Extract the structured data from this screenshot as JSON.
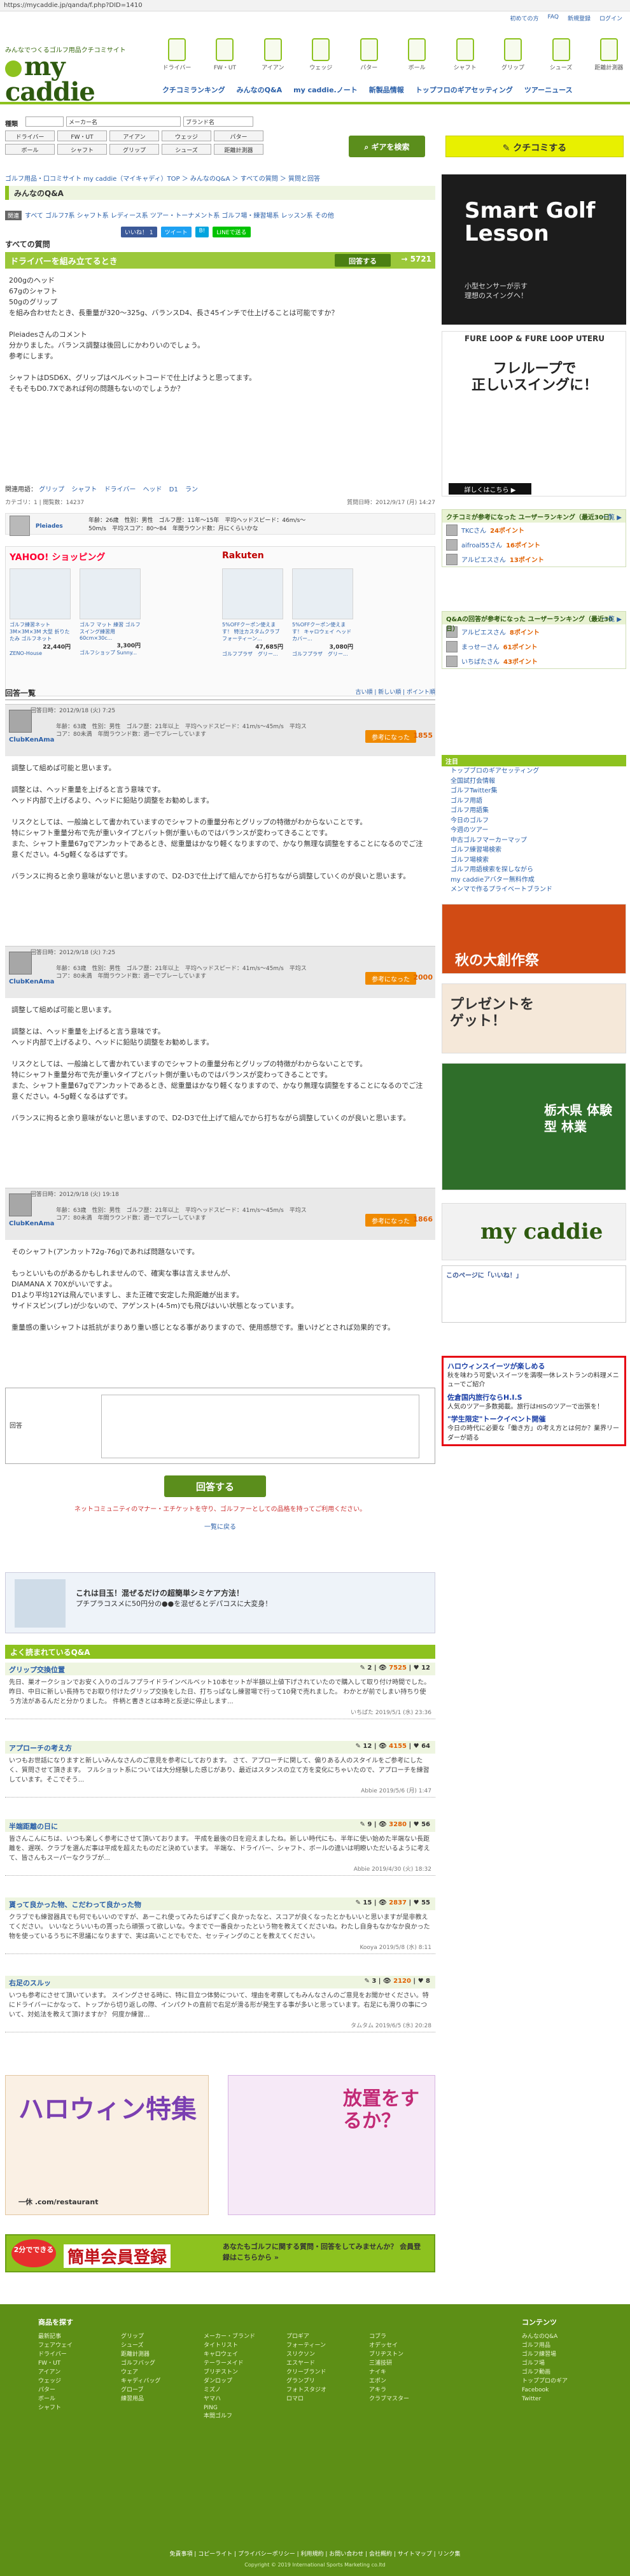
{
  "url": "https://mycaddie.jp/qanda/f.php?DID=1410",
  "top_meta": [
    "初めての方",
    "FAQ",
    "新規登録",
    "ログイン"
  ],
  "logo": {
    "tagline": "みんなでつくるゴルフ用品クチコミサイト",
    "name": "my caddie"
  },
  "icon_nav": [
    "ドライバー",
    "FW・UT",
    "アイアン",
    "ウェッジ",
    "パター",
    "ボール",
    "シャフト",
    "グリップ",
    "シューズ",
    "距離計測器"
  ],
  "main_nav": [
    "クチコミランキング",
    "みんなのQ&A",
    "my caddie.ノート",
    "新製品情報",
    "トップフロのギアセッティング",
    "ツアーニュース"
  ],
  "search": {
    "label_kind": "種類",
    "label_maker": "メーカー名",
    "label_brand": "ブランド名",
    "cats": [
      "ドライバー",
      "FW・UT",
      "アイアン",
      "ウェッジ",
      "パター",
      "ボール",
      "シャフト",
      "グリップ",
      "シューズ",
      "距離計測器"
    ],
    "button": "ギアを検索",
    "kuchikomi": "クチコミする"
  },
  "breadcrumb": "ゴルフ用品・口コミサイト my caddie（マイキャディ）TOP ＞ みんなのQ&A ＞ すべての質問 ＞ 質問と回答",
  "page_head": "みんなのQ&A",
  "cat_label": "関連",
  "categories": "すべて ゴルフ7系 シャフト系 レディース系 ツアー・トーナメント系 ゴルフ場・練習場系 レッスン系 その他",
  "social": {
    "fb": "いいね！ 1",
    "tw": "ツイート",
    "hatena": "B!",
    "line": "LINEで送る"
  },
  "question_section": "すべての質問",
  "question": {
    "title": "ドライバーを組み立てるとき",
    "answer_btn": "回答する",
    "count_prefix": "→",
    "count": "5721",
    "body": "200gのヘッド\n67gのシャフト\n50gのグリップ\nを組み合わせたとき、長重量が320〜325g、バランスD4、長さ45インチで仕上げることは可能ですか？\n\nPleiadesさんのコメント\n分かりました。バランス調整は後回しにかわりいのでしょう。\n参考にします。\n\nシャフトはDSD6X、グリップはベルベットコードで仕上げようと思ってます。\nそもそもD0.7Xであれば何の問題もないのでしょうか？",
    "tags_label": "関連用語：",
    "tags": [
      "グリップ",
      "シャフト",
      "ドライバー",
      "ヘッド",
      "D1",
      "ラン"
    ],
    "meta_left": "カテゴリ：1 | 閲覧数：14237",
    "meta_right": "質問日時：2012/9/17 (月) 14:27",
    "profile_name": "Pleiades",
    "profile_info": "年齢：26歳　性別：男性　ゴルフ歴：11年〜15年　平均ヘッドスピード：46m/s〜\n50m/s　平均スコア：80〜84　年間ラウンド数：月にくらいかな"
  },
  "shop_ads": {
    "yahoo": {
      "logo": "YAHOO! ショッピング",
      "items": [
        {
          "name": "ゴルフ練習ネット 3M×3M×3M 大型 折りたたみ ゴルフネット",
          "price": "22,440円",
          "shop": "ZENO-House"
        },
        {
          "name": "ゴルフ マット 練習 ゴルフ スイング練習用 60cm×30c...",
          "price": "3,300円",
          "shop": "ゴルフショップ Sunny..."
        }
      ]
    },
    "rakuten": {
      "logo": "Rakuten",
      "items": [
        {
          "name": "5%OFFクーポン使えます！ 特注カスタムクラブ フォーティーン...",
          "price": "47,685円",
          "shop": "ゴルフプラザ　グリー..."
        },
        {
          "name": "5%OFFクーポン使えます！ キャロウェイ ヘッドカバー...",
          "price": "3,080円",
          "shop": "ゴルフプラザ　グリー..."
        }
      ]
    }
  },
  "answers_head": "回答一覧",
  "answers_sort": "古い順 | 新しい順 | ポイント順",
  "answers": [
    {
      "date": "回答日時：2012/9/18 (火) 7:25",
      "name": "ClubKenAma",
      "profile": "年齢：63歳　性別：男性　ゴルフ歴：21年以上　平均ヘッドスピード：41m/s〜45m/s　平均スコア：80未満　年間ラウンド数：週一でプレーしています",
      "helpful": "参考になった",
      "points": "1855",
      "text": "調整して組めば可能と思います。\n\n調整とは、ヘッド重量を上げると言う意味です。\nヘッド内部で上げるより、ヘッドに鉛貼り調整をお勧めします。\n\nリスクとしては、一般論として書かれていますのでシャフトの重量分布とグリップの特徴がわからないことです。\n特にシャフト重量分布で先が重いタイプとバット側が重いものではバランスが変わってきることです。\nまた、シャフト重量67gでアンカットであるとき、総重量はかなり軽くなりますので、かなり無理な調整をすることになるのでご注意ください。4-5g軽くなるはずです。\n\nバランスに拘ると余り意味がないと思いますので、D2-D3で仕上げて組んでから打ちながら調整していくのが良いと思います。"
    },
    {
      "date": "回答日時：2012/9/18 (火) 7:25",
      "name": "ClubKenAma",
      "profile": "年齢：63歳　性別：男性　ゴルフ歴：21年以上　平均ヘッドスピード：41m/s〜45m/s　平均スコア：80未満　年間ラウンド数：週一でプレーしています",
      "helpful": "参考になった",
      "points": "2000",
      "text": "調整して組めば可能と思います。\n\n調整とは、ヘッド重量を上げると言う意味です。\nヘッド内部で上げるより、ヘッドに鉛貼り調整をお勧めします。\n\nリスクとしては、一般論として書かれていますのでシャフトの重量分布とグリップの特徴がわからないことです。\n特にシャフト重量分布で先が重いタイプとバット側が重いものではバランスが変わってきることです。\nまた、シャフト重量67gでアンカットであるとき、総重量はかなり軽くなりますので、かなり無理な調整をすることになるのでご注意ください。4-5g軽くなるはずです。\n\nバランスに拘ると余り意味がないと思いますので、D2-D3で仕上げて組んでから打ちながら調整していくのが良いと思います。"
    },
    {
      "date": "回答日時：2012/9/18 (火) 19:18",
      "name": "ClubKenAma",
      "profile": "年齢：63歳　性別：男性　ゴルフ歴：21年以上　平均ヘッドスピード：41m/s〜45m/s　平均スコア：80未満　年間ラウンド数：週一でプレーしています",
      "helpful": "参考になった",
      "points": "1866",
      "text": "そのシャフト(アンカット72g-76g)であれば問題ないです。\n\nもっといいものがあるかもしれませんので、確実な事は言えませんが、\nDIAMANA X 70Xがいいですよ。\nD1より平均12Yは飛んでいますし、また正確で安定した飛距離が出ます。\nサイドスピン(ブレ)が少ないので、アゲンスト(4-5m)でも飛びはいい状態となっています。\n\n重量感の重いシャフトは抵抗がまりあり重い感じとなる事がありますので、使用感想です。重いけどとされば効果的です。"
    }
  ],
  "reply": {
    "label": "回答",
    "submit": "回答する",
    "notice": "ネットコミュニティのマナー・エチケットを守り、ゴルファーとしての品格を持ってご利用ください。",
    "back": "一覧に戻る"
  },
  "banner1": {
    "line1": "これは目玉！混ぜるだけの超簡単シミケア方法！",
    "line2": "プチプラコスメに50円分の●●を混ぜるとデパコスに大変身！"
  },
  "popular_head": "よく読まれているQ&A",
  "popular": [
    {
      "title": "グリップ交換位置",
      "count_a": "2",
      "count_b": "7525",
      "count_c": "12",
      "body": "先日、巣オークションでお安く入りのゴルフプライドラインベルベット10本セットが半額以上値下げされていたので購入して取り付け時間でした。昨日、中日に新しい長持ちでお取り付けたグリップ交換をした日、打ちっぱなし練習場で行って10発で売れました。 わかとが前でしまい持ちり使う方法があるんだと分かりました。 件柄と書きとは本時と反逆に停止します... ",
      "meta": "いちばた 2019/5/1 (水) 23:36"
    },
    {
      "title": "アプローチの考え方",
      "count_a": "12",
      "count_b": "4155",
      "count_c": "64",
      "body": "いつもお世話になりますと新しいみんなさんのご意見を参考にしております。 さて、アプローチに関して、偏りある人のスタイルをご参考にしたく、質問させて頂きます。 フルショット系については大分経験した感じがあり、最近はスタンスの立て方を変化にちゃいたので、アプローチを練習しています。そこでそう... ",
      "meta": "Abbie 2019/5/6 (月) 1:47"
    },
    {
      "title": "半端距離の日に",
      "count_a": "9",
      "count_b": "3280",
      "count_c": "56",
      "body": "皆さんこんにちは、いつも楽しく参考にさせて頂いております。 平成を最後の日を迎えましたね。新しい時代にも、半年に使い始めた半端ない長距離を、遅咲、クラブを選んだ事は平成を超えたものだと決めています。 半端な、ドライバー、シャフト、ボールの違いは明瞭いただいるように考えて、皆さんもスーパーなクラブが... ",
      "meta": "Abbie 2019/4/30 (火) 18:32"
    },
    {
      "title": "貰って良かった物、こだわって良かった物",
      "count_a": "15",
      "count_b": "2837",
      "count_c": "55",
      "body": "クラブでも練習器具でも何でもいいのですが、あーこれ使ってみたらばすごく良かったなと、スコアが良くなったとかもいいと思いますが是非教えてください。 いいなとういいもの貰ったら頑張って欲しいな。今までで一番良かったという物を教えてくださいね。わたし自身もなかなか良かった物を使っているうちに不思議になりますで、実は高いことでもでた、セッティングのことを教えてください。",
      "meta": "Kooya 2019/5/8 (水) 8:11"
    },
    {
      "title": "右足のスルッ",
      "count_a": "3",
      "count_b": "2120",
      "count_c": "8",
      "body": "いつも参考にさせて頂いています。 スイングさせる時に、特に目立つ体勢について、埋由を考察してもみんなさんのご意見をお聞かせください。特にドライバーにかなって、トップから切り返しの際、インパクトの直前で右足が滑る形が発生する事が多いと思っています。右足にも滑りの事について、対処法を教えて頂けますか？ 何度か練習... ",
      "meta": "タムタム 2019/6/5 (水) 20:28"
    }
  ],
  "bottom_ads": {
    "halloween": "ハロウィン特集",
    "brand": "一休 .com/restaurant",
    "manga": "放置をするか？"
  },
  "register": {
    "two_min": "2分でできる",
    "big": "簡単会員登録",
    "sub": "あなたもゴルフに関する質問・回答をしてみませんか？ 会員登録はこちらから »"
  },
  "footer": {
    "search_head": "商品を探す",
    "col1": [
      "最新記事",
      "フェアウェイ",
      "ドライバー",
      "FW・UT",
      "アイアン",
      "ウェッジ",
      "パター",
      "ボール",
      "シャフト"
    ],
    "col2": [
      "グリップ",
      "シューズ",
      "距離計測器",
      "ゴルフバッグ",
      "ウェア",
      "キャディバッグ",
      "グローブ",
      "練習用品"
    ],
    "col3": [
      "メーカー・ブランド",
      "タイトリスト",
      "キャロウェイ",
      "テーラーメイド",
      "ブリヂストン",
      "ダンロップ",
      "ミズノ",
      "ヤマハ",
      "PING",
      "本間ゴルフ"
    ],
    "col4": [
      "プロギア",
      "フォーティーン",
      "スリクソン",
      "エスヤード",
      "クリーブランド",
      "グランプリ",
      "フォトスタジオ",
      "ロマロ"
    ],
    "col5": [
      "コブラ",
      "オデッセイ",
      "ブリヂストン",
      "三浦技研",
      "ナイキ",
      "エポン",
      "アキラ",
      "クラブマスター"
    ],
    "content_head": "コンテンツ",
    "col6": [
      "みんなのQ&A",
      "ゴルフ用品",
      "ゴルフ練習場",
      "ゴルフ場",
      "ゴルフ動画",
      "トッププロのギア",
      "Facebook",
      "Twitter"
    ],
    "links": "免責事項 | コピーライト | プライバシーポリシー | 利用規約 | お問い合わせ | 会社概約 | サイトマップ | リンク集",
    "copyright": "Copyright © 2019 International Sports Marketing co.ltd"
  },
  "sidebar": {
    "golf_ad_head": "Smart Golf Lesson",
    "golf_ad_sub": "小型センサーが示す\n理想のスイングへ！",
    "fure_head": "FURE LOOP & FURE LOOP UTERU",
    "fure_main": "フレループで\n正しいスイングに！",
    "fure_btn": "詳しくはこちら ▶",
    "rank1_head": "クチコミが参考になった ユーザーランキング（最近30日）",
    "rank1_more": "一覧 ▶",
    "rank1": [
      {
        "name": "TKCさん",
        "pt": "24ポイント"
      },
      {
        "name": "aifroal55さん",
        "pt": "16ポイント"
      },
      {
        "name": "アルピエスさん",
        "pt": "13ポイント"
      }
    ],
    "rank2_head": "Q&Aの回答が参考になった ユーザーランキング（最近30日）",
    "rank2_more": "一覧 ▶",
    "rank2": [
      {
        "name": "アルピエスさん",
        "pt": "8ポイント"
      },
      {
        "name": "まっせーさん",
        "pt": "61ポイント"
      },
      {
        "name": "いちばたさん",
        "pt": "43ポイント"
      }
    ],
    "links_head": "注目",
    "links": [
      "トップブロのギアセッティング",
      "全国試打会情報",
      "ゴルフTwitter集",
      "ゴルフ用語",
      "ゴルフ用語集",
      "今日のゴルフ",
      "今週のツアー",
      "中古ゴルフマーカーマップ",
      "ゴルフ練習場検索",
      "ゴルフ場検索",
      "ゴルフ用語検索を探しながら",
      "my caddieアバター無料作成",
      "メンマで作るプライベートブランド"
    ],
    "ad_autumn": "秋の大創作祭",
    "ad_present": "プレゼントをゲット！",
    "ad_tochigi": "栃木県 体験型 林業",
    "fb_label": "my caddie",
    "fb_like": "このページに「いいね！」",
    "pr_items": [
      {
        "t": "ハロウィンスイーツが楽しめる",
        "d": "秋を味わう可愛いスイーツを満喫一休レストランの料理メニューでご紹介"
      },
      {
        "t": "佐倉国内旅行ならH.I.S",
        "d": "人気のツアー多数掲載。旅行はHISのツアーで出張を！"
      },
      {
        "t": "\"学生限定\"トークイベント開催",
        "d": "今日の時代に必要な「働き方」の考え方とは何か？業界リーダーが語る"
      }
    ]
  }
}
